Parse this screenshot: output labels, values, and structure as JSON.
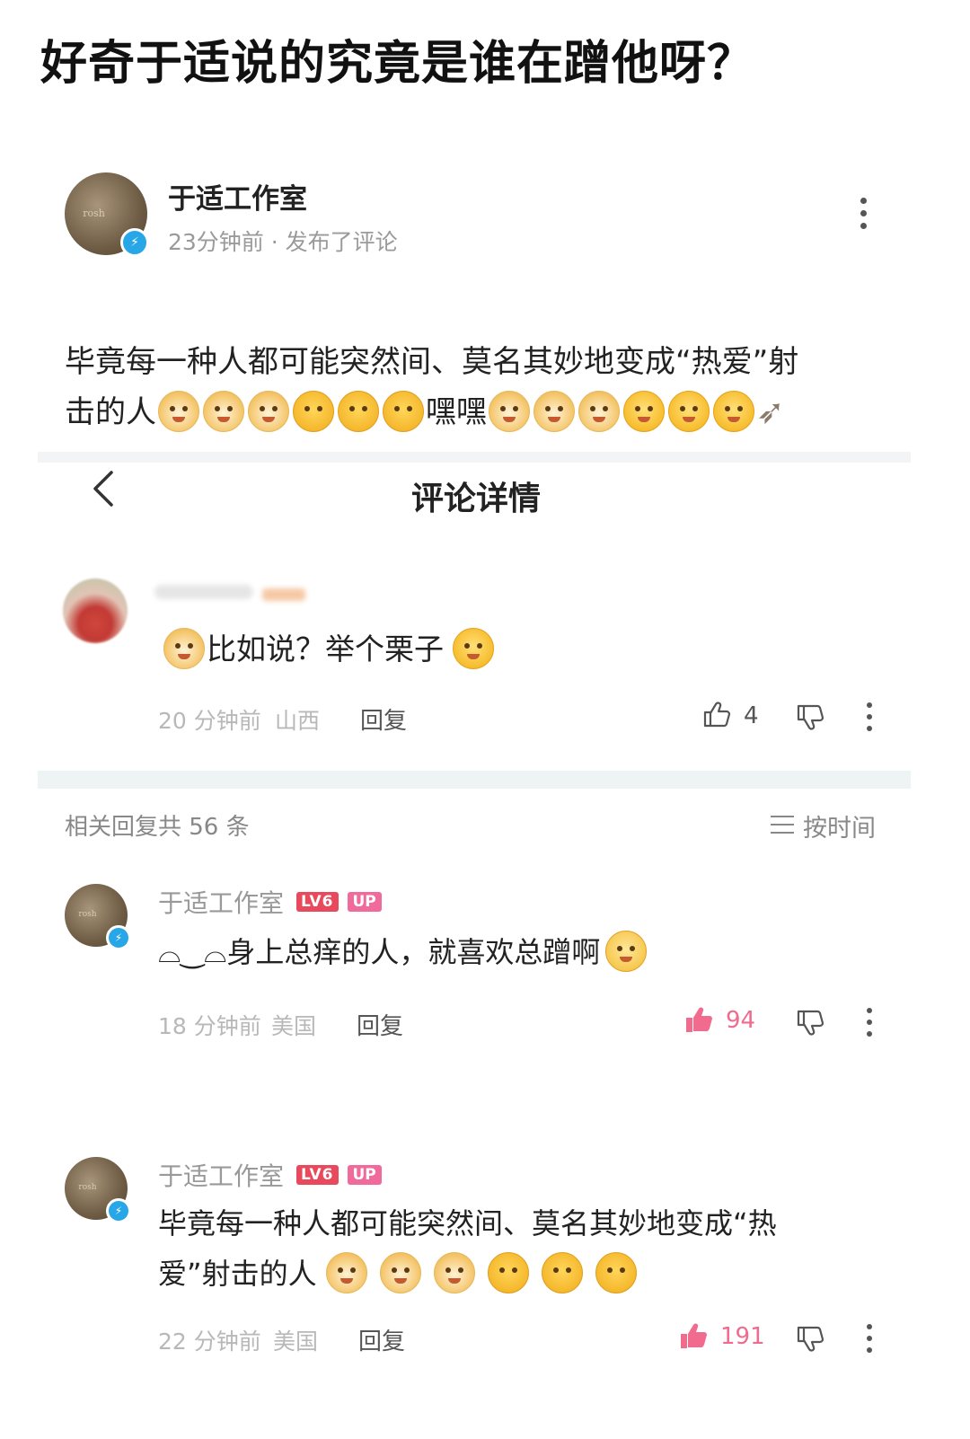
{
  "headline": "好奇于适说的究竟是谁在蹭他呀？",
  "post": {
    "author": "于适工作室",
    "meta": "23分钟前 · 发布了评论",
    "text_line1": "毕竟每一种人都可能突然间、莫名其妙地变成“热爱”射",
    "text_line2_prefix": "击的人",
    "text_line2_mid": "嘿嘿"
  },
  "detail_header": {
    "title": "评论详情",
    "back_icon": "chevron-left-icon"
  },
  "main_comment": {
    "text": "比如说？举个栗子",
    "time": "20 分钟前",
    "location": "山西",
    "reply_label": "回复",
    "likes": "4"
  },
  "replies_header": {
    "count_label": "相关回复共 56 条",
    "sort_label": "按时间"
  },
  "replies": [
    {
      "author": "于适工作室",
      "level": "LV6",
      "up": "UP",
      "text": "⌓‿⌓身上总痒的人，就喜欢总蹭啊",
      "time": "18 分钟前",
      "location": "美国",
      "reply_label": "回复",
      "likes": "94"
    },
    {
      "author": "于适工作室",
      "level": "LV6",
      "up": "UP",
      "text_line1": "毕竟每一种人都可能突然间、莫名其妙地变成“热",
      "text_line2": "爱”射击的人",
      "time": "22 分钟前",
      "location": "美国",
      "reply_label": "回复",
      "likes": "191"
    }
  ],
  "colors": {
    "like_active": "#f06b8e",
    "verified_badge": "#27a7e7",
    "level_badge": "#e8495c",
    "up_badge": "#f06b9b"
  }
}
